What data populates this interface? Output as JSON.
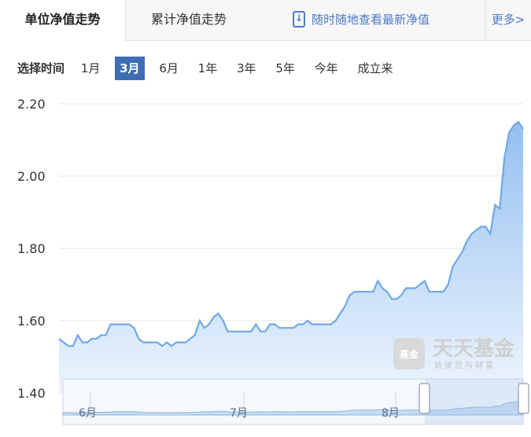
{
  "tabs": {
    "unit_nav_trend": "单位净值走势",
    "cumulative_nav_trend": "累计净值走势",
    "app_promo": "随时随地查看最新净值",
    "more": "更多>"
  },
  "period": {
    "label": "选择时间",
    "options": [
      "1月",
      "3月",
      "6月",
      "1年",
      "3年",
      "5年",
      "今年",
      "成立来"
    ],
    "selected": "3月"
  },
  "watermark": {
    "icon_text": "基金",
    "brand": "天天基金",
    "tagline": "链接您与财富"
  },
  "colors": {
    "line": "#6fa8e8",
    "fill_top": "#8ebcef",
    "fill_bottom": "#eaf3fc",
    "selected_period": "#3e6db5",
    "grid": "#e6e6e6"
  },
  "chart_data": {
    "type": "area",
    "ylim": [
      1.4,
      2.2
    ],
    "yticks": [
      "2.20",
      "2.00",
      "1.80",
      "1.60",
      "1.40"
    ],
    "navigator_labels": [
      "6月",
      "7月",
      "8月"
    ],
    "series": [
      {
        "values": [
          1.55,
          1.54,
          1.53,
          1.53,
          1.56,
          1.54,
          1.54,
          1.55,
          1.55,
          1.56,
          1.56,
          1.59,
          1.59,
          1.59,
          1.59,
          1.59,
          1.58,
          1.55,
          1.54,
          1.54,
          1.54,
          1.54,
          1.53,
          1.54,
          1.53,
          1.54,
          1.54,
          1.54,
          1.55,
          1.56,
          1.6,
          1.58,
          1.59,
          1.61,
          1.62,
          1.6,
          1.57,
          1.57,
          1.57,
          1.57,
          1.57,
          1.57,
          1.59,
          1.57,
          1.57,
          1.59,
          1.59,
          1.58,
          1.58,
          1.58,
          1.58,
          1.59,
          1.59,
          1.6,
          1.59,
          1.59,
          1.59,
          1.59,
          1.59,
          1.6,
          1.62,
          1.64,
          1.67,
          1.68,
          1.68,
          1.68,
          1.68,
          1.68,
          1.71,
          1.69,
          1.68,
          1.66,
          1.66,
          1.67,
          1.69,
          1.69,
          1.69,
          1.7,
          1.71,
          1.68,
          1.68,
          1.68,
          1.68,
          1.7,
          1.75,
          1.77,
          1.79,
          1.82,
          1.84,
          1.85,
          1.86,
          1.86,
          1.84,
          1.92,
          1.91,
          2.05,
          2.12,
          2.14,
          2.15,
          2.13
        ]
      }
    ]
  }
}
